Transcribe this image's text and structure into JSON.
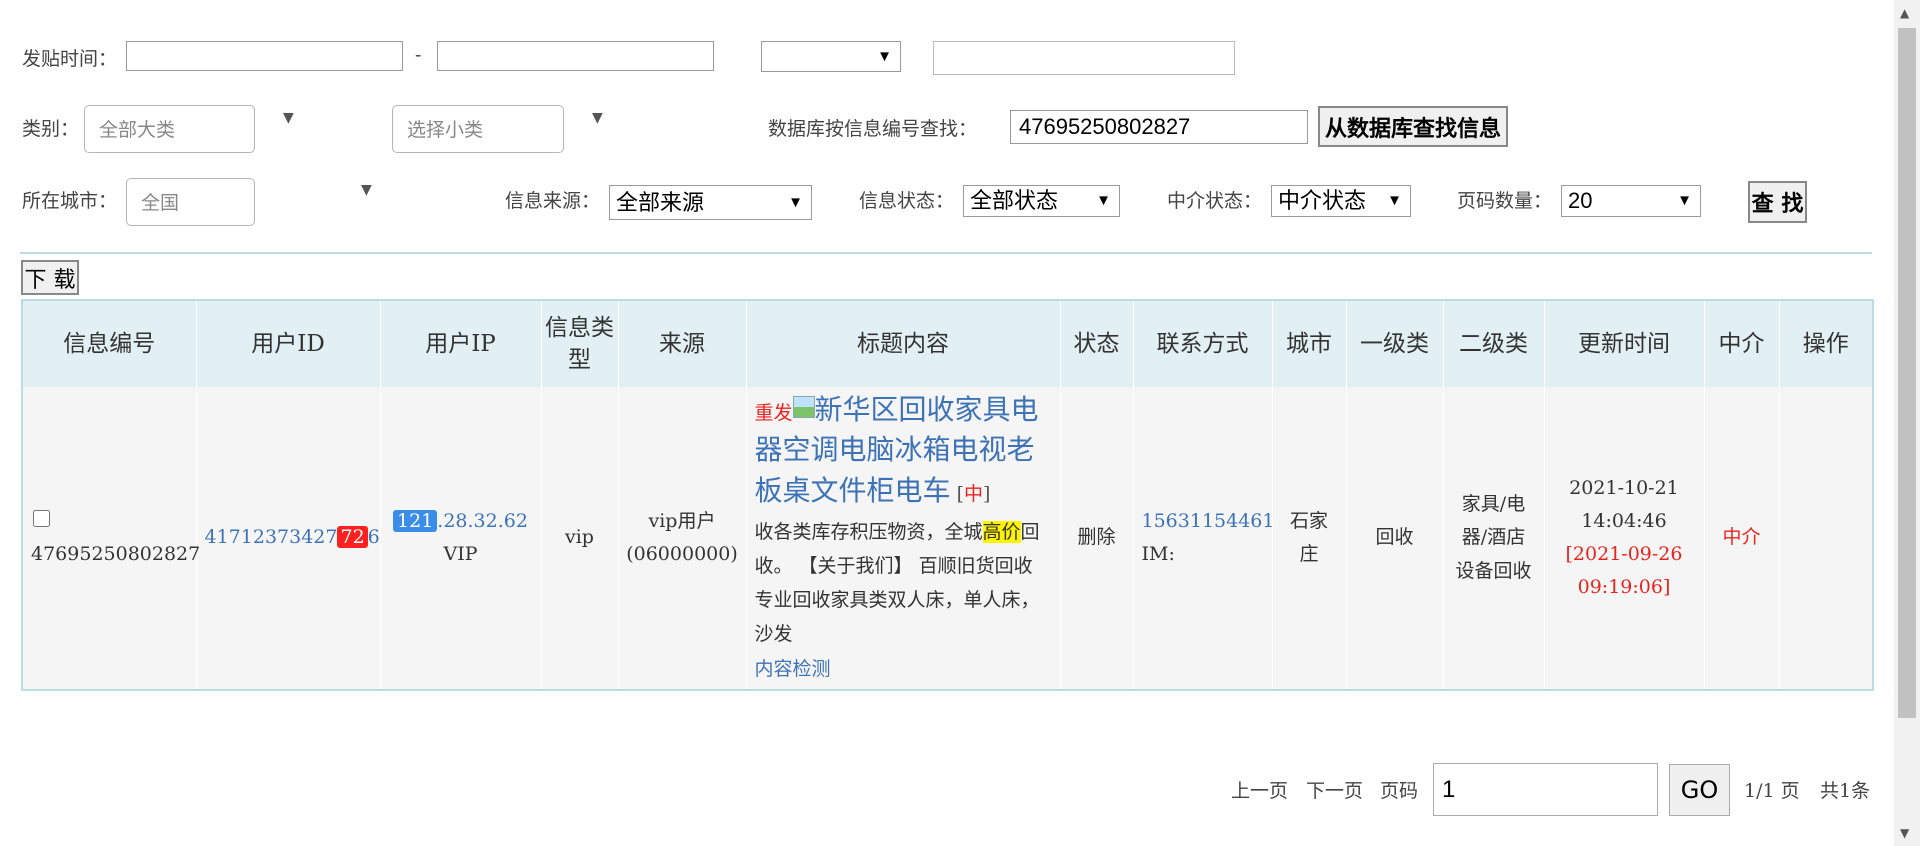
{
  "filters": {
    "post_time_label": "发贴时间：",
    "date_sep": "-",
    "date_from": "",
    "date_to": "",
    "extra_select": "",
    "extra_text": "",
    "category_label": "类别：",
    "category_placeholder": "全部大类",
    "subcategory_placeholder": "选择小类",
    "db_search_label": "数据库按信息编号查找：",
    "db_search_value": "47695250802827",
    "db_search_button": "从数据库查找信息",
    "city_label": "所在城市：",
    "city_placeholder": "全国",
    "source_label": "信息来源：",
    "source_value": "全部来源",
    "status_label": "信息状态：",
    "status_value": "全部状态",
    "agent_label": "中介状态：",
    "agent_value": "中介状态",
    "page_size_label": "页码数量：",
    "page_size_value": "20",
    "search_button": "查 找"
  },
  "download_button": "下 载",
  "table": {
    "headers": [
      "信息编号",
      "用户ID",
      "用户IP",
      "信息类型",
      "来源",
      "标题内容",
      "状态",
      "联系方式",
      "城市",
      "一级类",
      "二级类",
      "更新时间",
      "中介",
      "操作"
    ],
    "rows": [
      {
        "info_id": "47695250802827",
        "user_id_pre": "41712373427",
        "user_id_badge": "72",
        "user_id_post": "6",
        "ip_badge": "121",
        "ip_rest": ".28.32.62",
        "ip_tag": "VIP",
        "info_type": "vip",
        "source_line1": "vip用户",
        "source_line2": "(06000000)",
        "repost_tag": "重发",
        "title": "新华区回收家具电器空调电脑冰箱电视老板桌文件柜电车",
        "title_bracket_open": "[",
        "title_agent_tag": "中",
        "title_bracket_close": "]",
        "desc_1": "收各类库存积压物资，全城",
        "desc_hl_1": "高",
        "desc_hl_2": "价",
        "desc_2": "回收。 【关于我们】 百顺旧货回收专业回收家具类双人床，单人床，沙发",
        "content_check": "内容检测",
        "status": "删除",
        "phone": "15631154461",
        "im": "IM:",
        "city": "石家庄",
        "cat1": "回收",
        "cat2": "家具/电器/酒店设备回收",
        "update_time_1": "2021-10-21",
        "update_time_2": "14:04:46",
        "orig_time_1": "[2021-09-26",
        "orig_time_2": "09:19:06]",
        "agent": "中介",
        "action": ""
      }
    ]
  },
  "pager": {
    "prev": "上一页",
    "next": "下一页",
    "page_label": "页码",
    "page_value": "1",
    "go": "GO",
    "page_info": "1/1 页",
    "total": "共1条"
  }
}
